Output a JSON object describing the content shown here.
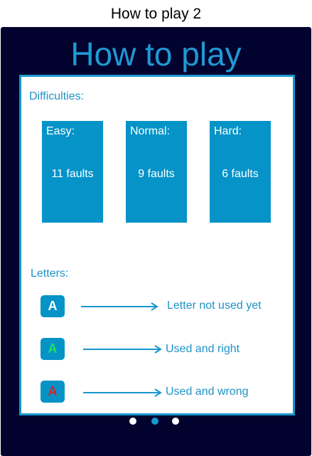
{
  "caption": "How to play 2",
  "screen": {
    "title": "How to play",
    "difficulties_label": "Difficulties:",
    "difficulties": [
      {
        "name": "Easy:",
        "faults": "11 faults"
      },
      {
        "name": "Normal:",
        "faults": "9 faults"
      },
      {
        "name": "Hard:",
        "faults": "6 faults"
      }
    ],
    "letters_label": "Letters:",
    "legend": [
      {
        "letter": "A",
        "letter_color": "#ffffff",
        "description": "Letter not used yet"
      },
      {
        "letter": "A",
        "letter_color": "#22e05a",
        "description": "Used and right"
      },
      {
        "letter": "A",
        "letter_color": "#e02020",
        "description": "Used and wrong"
      }
    ],
    "pager": {
      "count": 3,
      "active_index": 1
    }
  },
  "colors": {
    "background": "#02022e",
    "accent": "#1896cf",
    "card": "#0593c8",
    "dot_inactive": "#ffffff",
    "dot_active": "#1896cf"
  }
}
